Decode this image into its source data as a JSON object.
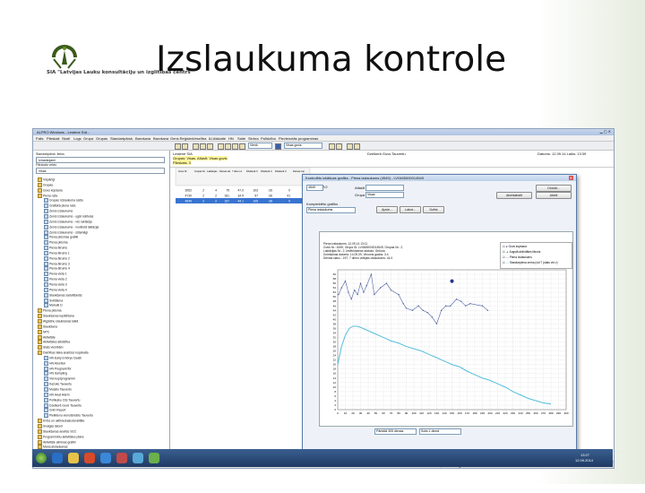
{
  "slide": {
    "title": "Izslaukuma kontrole",
    "org": "SIA \"Latvijas Lauku konsultāciju un izglītības centrs\""
  },
  "window": {
    "title": "ALPRO Windows - Lestene SIA - ",
    "menu": [
      "Fails",
      "Pārskati",
      "Skati",
      "Logs",
      "Grupa",
      "Grupas",
      "Standartpārsk.",
      "Barošana",
      "Barošana",
      "Gens.Reģistrs",
      "Veselība",
      "Ш.Atskaite",
      "HN",
      "Saite",
      "Sinhra",
      "Palīdzība",
      "Pievienotās programmas"
    ],
    "toolbar_combo": "Visas govis",
    "toolbar_combo2": "Vienk"
  },
  "left_pane": {
    "label1": "Standartpārsk. lietus",
    "combo1": "Izmantojami",
    "label2": "Pārskatu veids",
    "combo2": "Visas",
    "items": [
      {
        "label": "Vispārīgi",
        "child": false
      },
      {
        "label": "Grupas",
        "child": false
      },
      {
        "label": "Govs kopšana",
        "child": false
      },
      {
        "label": "Piena raža",
        "child": false
      },
      {
        "label": "Grupas izslaukuma saīšu",
        "child": true
      },
      {
        "label": "Grafiskā piena raža",
        "child": true
      },
      {
        "label": "Zems izslaukums",
        "child": true
      },
      {
        "label": "Zems izslaukums - ugāl. kārtulas",
        "child": true
      },
      {
        "label": "Zems izslaukums - vid. laktācija",
        "child": true
      },
      {
        "label": "Zems izslaukums - novēlotā laktācija",
        "child": true
      },
      {
        "label": "Zems izslaukums - sūtamāgi",
        "child": true
      },
      {
        "label": "Piena plūsmas grafiki",
        "child": true
      },
      {
        "label": "Piena plūsma",
        "child": true
      },
      {
        "label": "Piena ātrums",
        "child": true
      },
      {
        "label": "Piena ātrums 1",
        "child": true
      },
      {
        "label": "Piena ātrums 2",
        "child": true
      },
      {
        "label": "Piena ātrums 3",
        "child": true
      },
      {
        "label": "Piena ātrums 4",
        "child": true
      },
      {
        "label": "Piena vieta 1",
        "child": true
      },
      {
        "label": "Piena vieta 2",
        "child": true
      },
      {
        "label": "Piena vieta 3",
        "child": true
      },
      {
        "label": "Piena vieta 4",
        "child": true
      },
      {
        "label": "Slaukšanas sadalīšanās",
        "child": true
      },
      {
        "label": "Svētdiena",
        "child": true
      },
      {
        "label": "Manuāl D",
        "child": true
      },
      {
        "label": "Piena plūsma",
        "child": false
      },
      {
        "label": "Slaukšanas iepildīšana",
        "child": false
      },
      {
        "label": "Atgādinu slaukšanas laikā",
        "child": false
      },
      {
        "label": "Slaukšana",
        "child": false
      },
      {
        "label": "NPC",
        "child": false
      },
      {
        "label": "Aktivitāte",
        "child": false
      },
      {
        "label": "Aktivitātes atbilstība",
        "child": false
      },
      {
        "label": "Stats vienībām",
        "child": false
      },
      {
        "label": "Darbības laika analīzes kopskaita",
        "child": false
      },
      {
        "label": "HN Early Embryo Death",
        "child": true
      },
      {
        "label": "HN Abortion",
        "child": true
      },
      {
        "label": "HN Pregnant fbr",
        "child": true
      },
      {
        "label": "HN Sampling",
        "child": true
      },
      {
        "label": "Visi kopīprogrammi",
        "child": true
      },
      {
        "label": "Kažoks Tauvertu",
        "child": true
      },
      {
        "label": "Musēlu Tauvertu",
        "child": true
      },
      {
        "label": "HN Heat Alarm",
        "child": true
      },
      {
        "label": "Polīkuļku Cits Tauvertu",
        "child": true
      },
      {
        "label": "Dzelkerā Govs Tauvertu",
        "child": true
      },
      {
        "label": "Grim Report",
        "child": true
      },
      {
        "label": "Pieliktenu vienotā kārtu Tauvertu",
        "child": true
      },
      {
        "label": "Kvīss un aktīvieduakcionalitāte",
        "child": false
      },
      {
        "label": "Svaigas laiceri",
        "child": false
      },
      {
        "label": "Slaukšanas analīze SCC",
        "child": false
      },
      {
        "label": "Programmētu aktivitātes plāns",
        "child": false
      },
      {
        "label": "Aktivitāte atmiņas grafiki",
        "child": false
      },
      {
        "label": "Mana atslaukanas",
        "child": false
      }
    ],
    "tabs": [
      "Pārskati",
      "Grafiki",
      "Cik",
      "Ruļļa"
    ]
  },
  "main": {
    "farm": "Lestene SIA",
    "subtitle": "Grupas: Visas. Atlasīt: Visas govis",
    "view": "Pārskats: 3",
    "center_title": "Dzelkerā Govs Tauvertu",
    "right_date": "Datums: 12.09.14 Laiks: 13:39",
    "columns": [
      "Govs Nr.",
      "Grupas Nr.",
      "Laktācijas Nr.",
      "Dienas slauc.",
      "7 dienu vidējais izslaukums",
      "Dzelkerā Cits Rādīti 1",
      "Dzelkerā Cits Rādīti",
      "Dzelkerā Cits Tauvertu impuls",
      "Dienas impuls aktīvitātes"
    ],
    "rows": [
      [
        "3052",
        "2",
        "4",
        "75",
        "47.0",
        "103",
        "-26",
        "0",
        "24"
      ],
      [
        "4730",
        "2",
        "2",
        "181",
        "34.9",
        "97",
        "-36",
        "41",
        "24"
      ],
      [
        "4549",
        "2",
        "2",
        "197",
        "44.1",
        "105",
        "-38",
        "9",
        "24"
      ]
    ]
  },
  "dialog": {
    "title": "Kontrolēts izkāšņas grafiks - Piena izslaukums (4549) - LV0465000014549",
    "cow_label": "4549",
    "zoom": "7/2",
    "group_label": "Grupa",
    "group_value": "Visas",
    "filter_label": "Atlasīt",
    "btn_print": "Drukāt...",
    "btn_cancel": "Atcelt",
    "btn_ok": "Atcelsabstīt",
    "section_label": "Komplektētu grafiks",
    "chart_combo": "Piena izslaukums",
    "btn_apply": "Apvie...",
    "btn_label": "Labot...",
    "btn_delete": "Dzēst",
    "meta": [
      "Piena izslaukums: 12.09.14 13:11",
      "Govs Nr.: 4549, Grupa ID: LV0465000014549, Grupas Nr.: 2,",
      "Laktācijas Nr.: 2, Iesēklošanas statuss: Grūsna",
      "Dzimšanas datums: 14.09.09, Vecums gados: 3.4",
      "Dienas slauc.: 197, 7 dienu vidējais izslaukums: 44.0"
    ],
    "legend": [
      "Govs kopšana",
      "Augstā aktivitātes liknois",
      "Piena Izslaukums",
      "Standarpiena zema (vid 7 (stato vid v)"
    ],
    "bottom_combo1": "Pārbūtā 305 dienas",
    "bottom_combo2": "Solis 1 dienā"
  },
  "status_bar": {
    "left": "",
    "right": "ALPRO farka 1313, 12.09.14 Kg CAP NUM"
  },
  "taskbar": {
    "time": "13:27",
    "date": "12.09.2014"
  },
  "chart_data": {
    "type": "line",
    "x": [
      0,
      10,
      20,
      30,
      40,
      50,
      60,
      70,
      80,
      90,
      100,
      110,
      120,
      130,
      140,
      150,
      160,
      170,
      180,
      190,
      200,
      210,
      220,
      230,
      240,
      250,
      260,
      270,
      280,
      290,
      300
    ],
    "xlim": [
      0,
      300
    ],
    "ylim": [
      0,
      62
    ],
    "yticks": [
      0,
      2,
      4,
      6,
      8,
      10,
      12,
      14,
      16,
      18,
      20,
      22,
      24,
      26,
      28,
      30,
      32,
      34,
      36,
      38,
      40,
      42,
      44,
      46,
      48,
      50,
      52,
      54,
      56,
      58,
      60
    ],
    "series": [
      {
        "name": "Piena Izslaukums",
        "color": "#5060a0",
        "points": [
          [
            1,
            51
          ],
          [
            5,
            54
          ],
          [
            10,
            57
          ],
          [
            14,
            52
          ],
          [
            18,
            49
          ],
          [
            22,
            53
          ],
          [
            26,
            51
          ],
          [
            30,
            56
          ],
          [
            34,
            52
          ],
          [
            38,
            55
          ],
          [
            44,
            60
          ],
          [
            48,
            51
          ],
          [
            56,
            54
          ],
          [
            64,
            56
          ],
          [
            70,
            53
          ],
          [
            80,
            51
          ],
          [
            86,
            47
          ],
          [
            90,
            45
          ],
          [
            98,
            44
          ],
          [
            106,
            46
          ],
          [
            112,
            44
          ],
          [
            118,
            43
          ],
          [
            124,
            41
          ],
          [
            130,
            38
          ],
          [
            136,
            44
          ],
          [
            142,
            46
          ],
          [
            148,
            46
          ],
          [
            156,
            49
          ],
          [
            162,
            48
          ],
          [
            168,
            46
          ],
          [
            174,
            47
          ],
          [
            190,
            46
          ],
          [
            197,
            44
          ]
        ]
      },
      {
        "name": "Standarpiena zema",
        "color": "#40b8d8",
        "points": [
          [
            0,
            20
          ],
          [
            5,
            28
          ],
          [
            10,
            33
          ],
          [
            15,
            36
          ],
          [
            20,
            37
          ],
          [
            25,
            37
          ],
          [
            30,
            36.5
          ],
          [
            40,
            35
          ],
          [
            50,
            33.5
          ],
          [
            60,
            32
          ],
          [
            70,
            30.5
          ],
          [
            80,
            29.5
          ],
          [
            90,
            28
          ],
          [
            100,
            27
          ],
          [
            110,
            26
          ],
          [
            120,
            24.5
          ],
          [
            130,
            23
          ],
          [
            140,
            21.5
          ],
          [
            150,
            20
          ],
          [
            160,
            19
          ],
          [
            170,
            17
          ],
          [
            180,
            15.5
          ],
          [
            190,
            14
          ],
          [
            200,
            13
          ],
          [
            210,
            11.5
          ],
          [
            220,
            10
          ],
          [
            230,
            8
          ],
          [
            240,
            6.5
          ],
          [
            250,
            5
          ],
          [
            260,
            4
          ],
          [
            270,
            3
          ],
          [
            280,
            2.5
          ]
        ]
      },
      {
        "name": "Govs kopšana",
        "color": "#223388",
        "points": [
          [
            150,
            57
          ]
        ]
      }
    ]
  }
}
